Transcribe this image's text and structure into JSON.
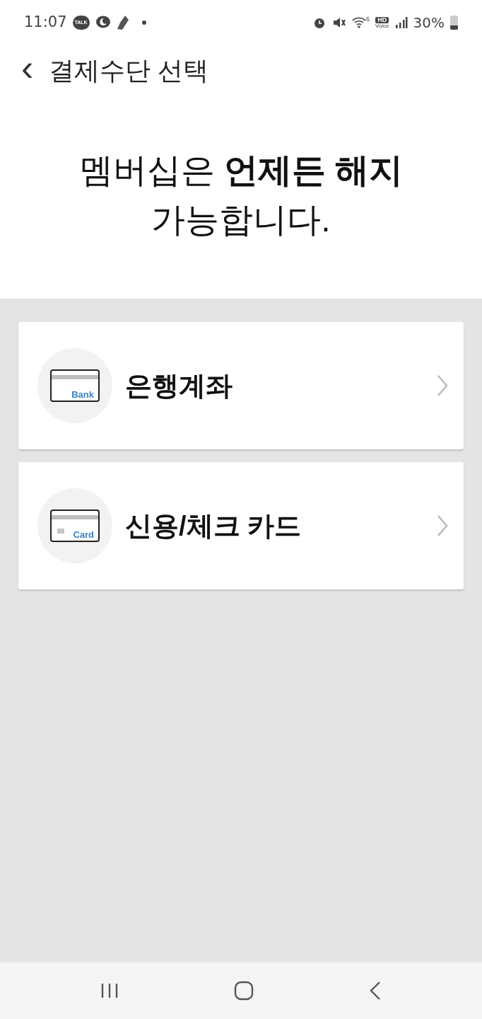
{
  "status_bar": {
    "time": "11:07",
    "talk_badge": "TALK",
    "network_badge": "HD",
    "network_sub": "Voice",
    "wifi_sub": "6",
    "battery": "30%"
  },
  "header": {
    "back": "‹",
    "title": "결제수단 선택"
  },
  "headline": "멤버십은 **언제든 해지** 가능합니다.",
  "methods": [
    {
      "kind": "bank",
      "icon_label": "Bank",
      "label": "은행계좌"
    },
    {
      "kind": "card",
      "icon_label": "Card",
      "label": "신용/체크 카드"
    }
  ]
}
